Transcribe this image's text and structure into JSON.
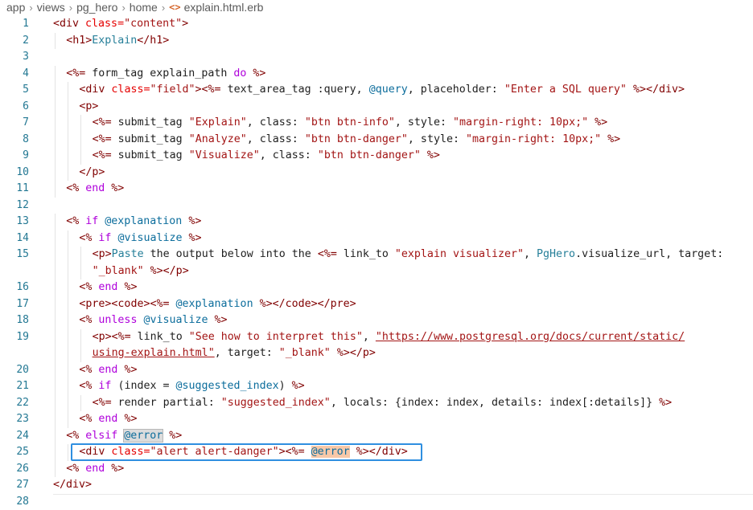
{
  "breadcrumb": {
    "items": [
      "app",
      "views",
      "pg_hero",
      "home"
    ],
    "file_icon": "<>",
    "file": "explain.html.erb"
  },
  "colors": {
    "tag": "#800000",
    "attribute": "#e50000",
    "string": "#a31515",
    "keyword": "#af00db",
    "instance_var": "#0c6d9c",
    "line_number": "#237893",
    "selection_box": "#2f8fe0"
  },
  "selected_line": "25",
  "lines": [
    {
      "n": "1",
      "indent": 0,
      "tokens": [
        {
          "t": "<div",
          "c": "tag"
        },
        {
          "t": " class=",
          "c": "attr"
        },
        {
          "t": "\"content\"",
          "c": "str"
        },
        {
          "t": ">",
          "c": "tag"
        }
      ]
    },
    {
      "n": "2",
      "indent": 1,
      "tokens": [
        {
          "t": "<h1>",
          "c": "tag"
        },
        {
          "t": "Explain",
          "c": "konst"
        },
        {
          "t": "</h1>",
          "c": "tag"
        }
      ]
    },
    {
      "n": "3",
      "indent": 0,
      "tokens": []
    },
    {
      "n": "4",
      "indent": 1,
      "tokens": [
        {
          "t": "<%=",
          "c": "dl"
        },
        {
          "t": " form_tag explain_path ",
          "c": "plain"
        },
        {
          "t": "do",
          "c": "kw"
        },
        {
          "t": " %>",
          "c": "dl"
        }
      ]
    },
    {
      "n": "5",
      "indent": 2,
      "tokens": [
        {
          "t": "<div",
          "c": "tag"
        },
        {
          "t": " class=",
          "c": "attr"
        },
        {
          "t": "\"field\"",
          "c": "str"
        },
        {
          "t": ">",
          "c": "tag"
        },
        {
          "t": "<%=",
          "c": "dl"
        },
        {
          "t": " text_area_tag :query, ",
          "c": "plain"
        },
        {
          "t": "@query",
          "c": "ivar"
        },
        {
          "t": ", placeholder: ",
          "c": "plain"
        },
        {
          "t": "\"Enter a SQL query\"",
          "c": "str"
        },
        {
          "t": " %>",
          "c": "dl"
        },
        {
          "t": "</div>",
          "c": "tag"
        }
      ]
    },
    {
      "n": "6",
      "indent": 2,
      "tokens": [
        {
          "t": "<p>",
          "c": "tag"
        }
      ]
    },
    {
      "n": "7",
      "indent": 3,
      "tokens": [
        {
          "t": "<%=",
          "c": "dl"
        },
        {
          "t": " submit_tag ",
          "c": "plain"
        },
        {
          "t": "\"Explain\"",
          "c": "str"
        },
        {
          "t": ", class: ",
          "c": "plain"
        },
        {
          "t": "\"btn btn-info\"",
          "c": "str"
        },
        {
          "t": ", style: ",
          "c": "plain"
        },
        {
          "t": "\"margin-right: 10px;\"",
          "c": "str"
        },
        {
          "t": " %>",
          "c": "dl"
        }
      ]
    },
    {
      "n": "8",
      "indent": 3,
      "tokens": [
        {
          "t": "<%=",
          "c": "dl"
        },
        {
          "t": " submit_tag ",
          "c": "plain"
        },
        {
          "t": "\"Analyze\"",
          "c": "str"
        },
        {
          "t": ", class: ",
          "c": "plain"
        },
        {
          "t": "\"btn btn-danger\"",
          "c": "str"
        },
        {
          "t": ", style: ",
          "c": "plain"
        },
        {
          "t": "\"margin-right: 10px;\"",
          "c": "str"
        },
        {
          "t": " %>",
          "c": "dl"
        }
      ]
    },
    {
      "n": "9",
      "indent": 3,
      "tokens": [
        {
          "t": "<%=",
          "c": "dl"
        },
        {
          "t": " submit_tag ",
          "c": "plain"
        },
        {
          "t": "\"Visualize\"",
          "c": "str"
        },
        {
          "t": ", class: ",
          "c": "plain"
        },
        {
          "t": "\"btn btn-danger\"",
          "c": "str"
        },
        {
          "t": " %>",
          "c": "dl"
        }
      ]
    },
    {
      "n": "10",
      "indent": 2,
      "tokens": [
        {
          "t": "</p>",
          "c": "tag"
        }
      ]
    },
    {
      "n": "11",
      "indent": 1,
      "tokens": [
        {
          "t": "<%",
          "c": "dl"
        },
        {
          "t": " end",
          "c": "kw"
        },
        {
          "t": " %>",
          "c": "dl"
        }
      ]
    },
    {
      "n": "12",
      "indent": 0,
      "tokens": []
    },
    {
      "n": "13",
      "indent": 1,
      "tokens": [
        {
          "t": "<%",
          "c": "dl"
        },
        {
          "t": " if",
          "c": "kw"
        },
        {
          "t": " @explanation",
          "c": "ivar"
        },
        {
          "t": " %>",
          "c": "dl"
        }
      ]
    },
    {
      "n": "14",
      "indent": 2,
      "tokens": [
        {
          "t": "<%",
          "c": "dl"
        },
        {
          "t": " if",
          "c": "kw"
        },
        {
          "t": " @visualize",
          "c": "ivar"
        },
        {
          "t": " %>",
          "c": "dl"
        }
      ]
    },
    {
      "n": "15",
      "indent": 3,
      "tokens": [
        {
          "t": "<p>",
          "c": "tag"
        },
        {
          "t": "Paste",
          "c": "konst"
        },
        {
          "t": " the output below into the ",
          "c": "plain"
        },
        {
          "t": "<%=",
          "c": "dl"
        },
        {
          "t": " link_to ",
          "c": "plain"
        },
        {
          "t": "\"explain visualizer\"",
          "c": "str"
        },
        {
          "t": ", ",
          "c": "plain"
        },
        {
          "t": "PgHero",
          "c": "konst"
        },
        {
          "t": ".visualize_url, target:",
          "c": "plain"
        }
      ]
    },
    {
      "n": "",
      "indent": 3,
      "tokens": [
        {
          "t": "\"_blank\"",
          "c": "str"
        },
        {
          "t": " %>",
          "c": "dl"
        },
        {
          "t": "</p>",
          "c": "tag"
        }
      ]
    },
    {
      "n": "16",
      "indent": 2,
      "tokens": [
        {
          "t": "<%",
          "c": "dl"
        },
        {
          "t": " end",
          "c": "kw"
        },
        {
          "t": " %>",
          "c": "dl"
        }
      ]
    },
    {
      "n": "17",
      "indent": 2,
      "tokens": [
        {
          "t": "<pre>",
          "c": "tag"
        },
        {
          "t": "<code>",
          "c": "tag"
        },
        {
          "t": "<%=",
          "c": "dl"
        },
        {
          "t": " @explanation",
          "c": "ivar"
        },
        {
          "t": " %>",
          "c": "dl"
        },
        {
          "t": "</code>",
          "c": "tag"
        },
        {
          "t": "</pre>",
          "c": "tag"
        }
      ]
    },
    {
      "n": "18",
      "indent": 2,
      "tokens": [
        {
          "t": "<%",
          "c": "dl"
        },
        {
          "t": " unless",
          "c": "kw"
        },
        {
          "t": " @visualize",
          "c": "ivar"
        },
        {
          "t": " %>",
          "c": "dl"
        }
      ]
    },
    {
      "n": "19",
      "indent": 3,
      "tokens": [
        {
          "t": "<p>",
          "c": "tag"
        },
        {
          "t": "<%=",
          "c": "dl"
        },
        {
          "t": " link_to ",
          "c": "plain"
        },
        {
          "t": "\"See how to interpret this\"",
          "c": "str"
        },
        {
          "t": ", ",
          "c": "plain"
        },
        {
          "t": "\"https://www.postgresql.org/docs/current/static/",
          "c": "str",
          "u": true
        }
      ]
    },
    {
      "n": "",
      "indent": 3,
      "tokens": [
        {
          "t": "using-explain.html\"",
          "c": "str",
          "u": true
        },
        {
          "t": ", target: ",
          "c": "plain"
        },
        {
          "t": "\"_blank\"",
          "c": "str"
        },
        {
          "t": " %>",
          "c": "dl"
        },
        {
          "t": "</p>",
          "c": "tag"
        }
      ]
    },
    {
      "n": "20",
      "indent": 2,
      "tokens": [
        {
          "t": "<%",
          "c": "dl"
        },
        {
          "t": " end",
          "c": "kw"
        },
        {
          "t": " %>",
          "c": "dl"
        }
      ]
    },
    {
      "n": "21",
      "indent": 2,
      "tokens": [
        {
          "t": "<%",
          "c": "dl"
        },
        {
          "t": " if",
          "c": "kw"
        },
        {
          "t": " (index = ",
          "c": "plain"
        },
        {
          "t": "@suggested_index",
          "c": "ivar"
        },
        {
          "t": ")",
          "c": "plain"
        },
        {
          "t": " %>",
          "c": "dl"
        }
      ]
    },
    {
      "n": "22",
      "indent": 3,
      "tokens": [
        {
          "t": "<%=",
          "c": "dl"
        },
        {
          "t": " render partial: ",
          "c": "plain"
        },
        {
          "t": "\"suggested_index\"",
          "c": "str"
        },
        {
          "t": ", locals: {index: index, details: index[:details]}",
          "c": "plain"
        },
        {
          "t": " %>",
          "c": "dl"
        }
      ]
    },
    {
      "n": "23",
      "indent": 2,
      "tokens": [
        {
          "t": "<%",
          "c": "dl"
        },
        {
          "t": " end",
          "c": "kw"
        },
        {
          "t": " %>",
          "c": "dl"
        }
      ]
    },
    {
      "n": "24",
      "indent": 1,
      "tokens": [
        {
          "t": "<%",
          "c": "dl"
        },
        {
          "t": " elsif ",
          "c": "kw"
        },
        {
          "t": "@error",
          "c": "ivar",
          "hl": "word"
        },
        {
          "t": " %>",
          "c": "dl"
        }
      ]
    },
    {
      "n": "25",
      "indent": 2,
      "tokens": [
        {
          "t": "<div",
          "c": "tag"
        },
        {
          "t": " class=",
          "c": "attr"
        },
        {
          "t": "\"alert alert-danger\"",
          "c": "str"
        },
        {
          "t": ">",
          "c": "tag"
        },
        {
          "t": "<%=",
          "c": "dl"
        },
        {
          "t": " ",
          "c": "plain"
        },
        {
          "t": "@error",
          "c": "ivar",
          "hl": "sel"
        },
        {
          "t": " %>",
          "c": "dl"
        },
        {
          "t": "</div>",
          "c": "tag"
        }
      ]
    },
    {
      "n": "26",
      "indent": 1,
      "tokens": [
        {
          "t": "<%",
          "c": "dl"
        },
        {
          "t": " end",
          "c": "kw"
        },
        {
          "t": " %>",
          "c": "dl"
        }
      ]
    },
    {
      "n": "27",
      "indent": 0,
      "tokens": [
        {
          "t": "</div>",
          "c": "tag"
        }
      ]
    },
    {
      "n": "28",
      "indent": 0,
      "tokens": []
    }
  ]
}
